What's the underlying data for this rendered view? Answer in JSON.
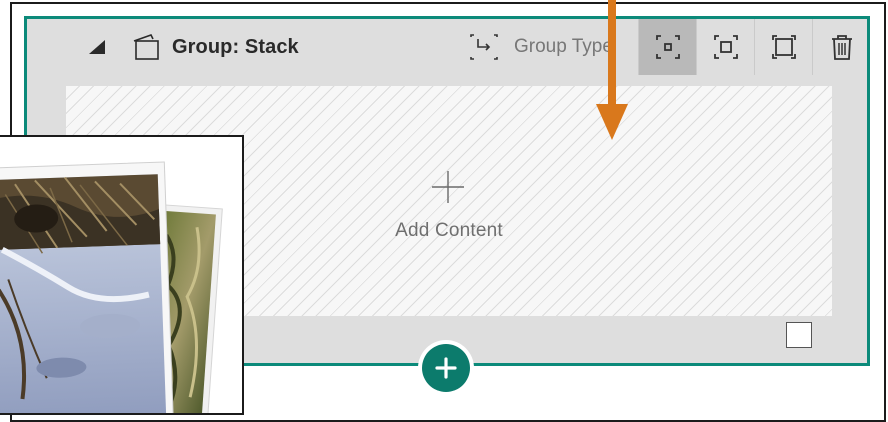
{
  "toolbar": {
    "title": "Group: Stack",
    "group_type_label": "Group Type",
    "buttons": {
      "small": "small-size",
      "medium": "medium-size",
      "large": "large-size",
      "delete": "delete"
    }
  },
  "content": {
    "add_content_label": "Add Content"
  },
  "colors": {
    "accent": "#0c7b6c",
    "outline": "#0c8a7a",
    "arrow": "#d9781c"
  },
  "icons": [
    "collapse-triangle-icon",
    "group-icon",
    "group-type-icon",
    "small-size-icon",
    "medium-size-icon",
    "large-size-icon",
    "trash-icon",
    "plus-icon",
    "add-section-plus-icon"
  ]
}
